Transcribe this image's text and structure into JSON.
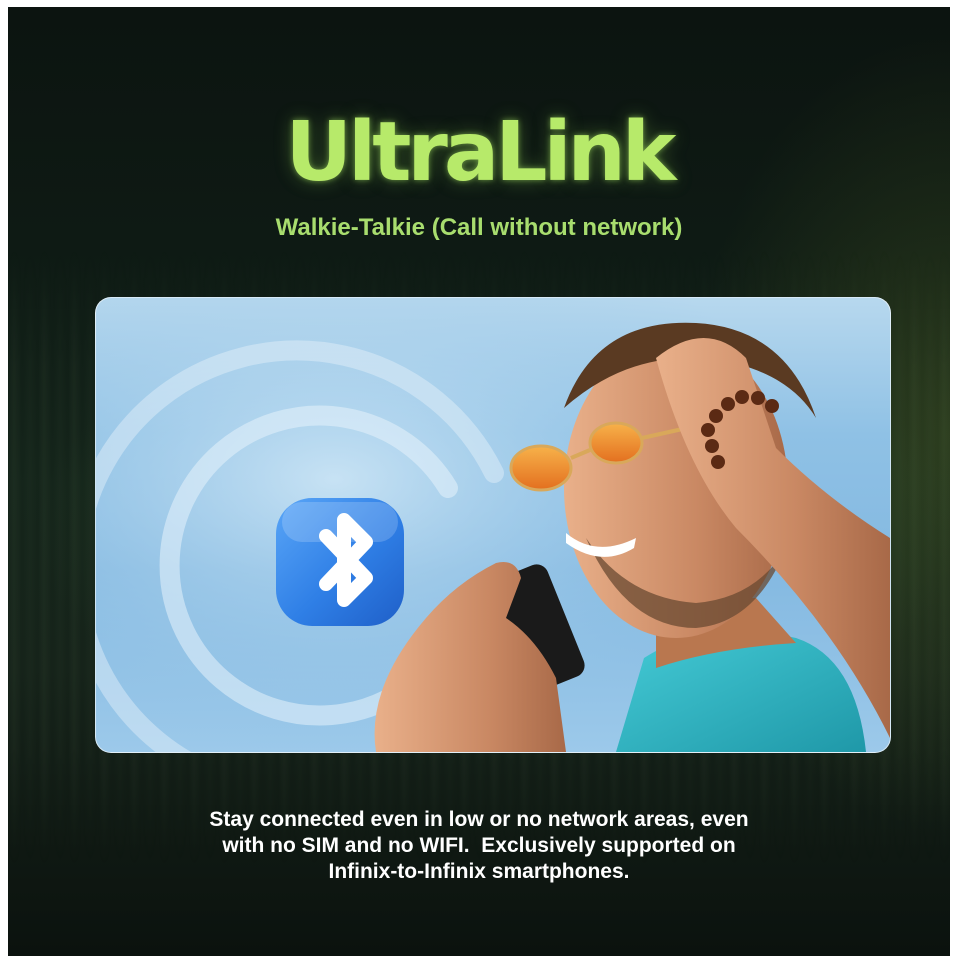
{
  "headline": {
    "title": "UltraLink",
    "subtitle": "Walkie-Talkie (Call without network)"
  },
  "hero_image": {
    "icon": "bluetooth-icon",
    "subject": "man-on-phone-call"
  },
  "description": {
    "line_1": "Stay connected even in low or no network areas, even",
    "line_2": "with no SIM and no WIFI.  Exclusively supported on",
    "line_3": "Infinix-to-Infinix smartphones."
  },
  "colors": {
    "accent": "#b7ea6a",
    "subtitle": "#a8dd6e",
    "background": "#0e1a14",
    "sky": "#8fc1e5",
    "bluetooth_tile": "#2f7fe6",
    "shirt": "#2fb8c6"
  }
}
